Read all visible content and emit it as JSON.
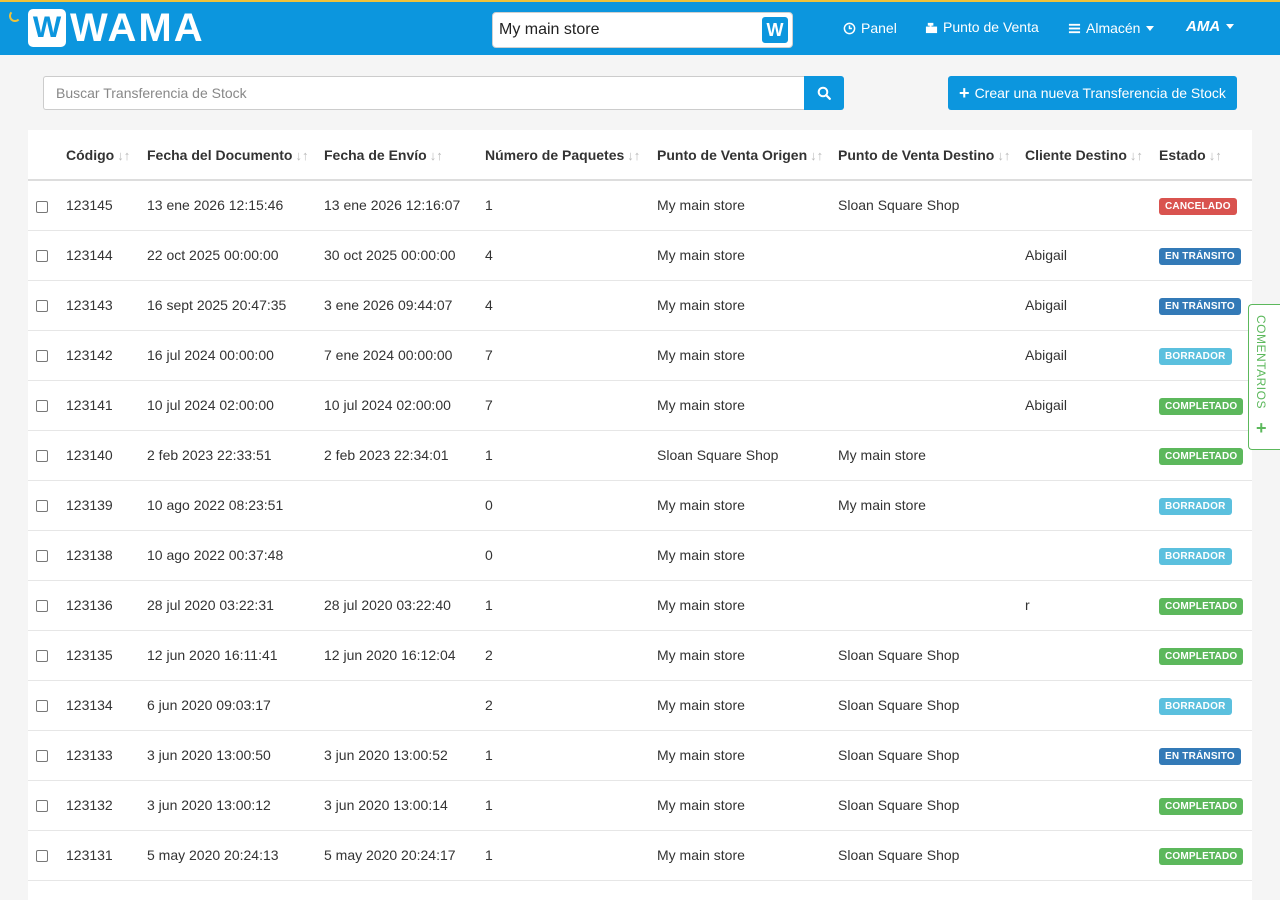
{
  "header": {
    "logo_text": "WAMA",
    "logo_mark": "W",
    "store_selector": {
      "value": "My main store",
      "badge": "W"
    },
    "nav": [
      {
        "label": "Panel",
        "icon": "clock-icon"
      },
      {
        "label": "Punto de Venta",
        "icon": "cash-register-icon"
      },
      {
        "label": "Almacén",
        "icon": "menu-icon"
      }
    ],
    "account_label": "AMA"
  },
  "search": {
    "placeholder": "Buscar Transferencia de Stock",
    "value": ""
  },
  "create_button": {
    "label": "Crear una nueva Transferencia de Stock"
  },
  "table": {
    "columns": [
      "Código",
      "Fecha del Documento",
      "Fecha de Envío",
      "Número de Paquetes",
      "Punto de Venta Origen",
      "Punto de Venta Destino",
      "Cliente Destino",
      "Estado"
    ],
    "rows": [
      {
        "code": "123145",
        "doc_date": "13 ene 2026 12:15:46",
        "ship_date": "13 ene 2026 12:16:07",
        "packages": "1",
        "origin": "My main store",
        "dest": "Sloan Square Shop",
        "client": "",
        "status": "CANCELADO",
        "color": "#d9534f"
      },
      {
        "code": "123144",
        "doc_date": "22 oct 2025 00:00:00",
        "ship_date": "30 oct 2025 00:00:00",
        "packages": "4",
        "origin": "My main store",
        "dest": "",
        "client": "Abigail",
        "status": "EN TRÁNSITO",
        "color": "#337ab7"
      },
      {
        "code": "123143",
        "doc_date": "16 sept 2025 20:47:35",
        "ship_date": "3 ene 2026 09:44:07",
        "packages": "4",
        "origin": "My main store",
        "dest": "",
        "client": "Abigail",
        "status": "EN TRÁNSITO",
        "color": "#337ab7"
      },
      {
        "code": "123142",
        "doc_date": "16 jul 2024 00:00:00",
        "ship_date": "7 ene 2024 00:00:00",
        "packages": "7",
        "origin": "My main store",
        "dest": "",
        "client": "Abigail",
        "status": "BORRADOR",
        "color": "#5bc0de"
      },
      {
        "code": "123141",
        "doc_date": "10 jul 2024 02:00:00",
        "ship_date": "10 jul 2024 02:00:00",
        "packages": "7",
        "origin": "My main store",
        "dest": "",
        "client": "Abigail",
        "status": "COMPLETADO",
        "color": "#5cb85c"
      },
      {
        "code": "123140",
        "doc_date": "2 feb 2023 22:33:51",
        "ship_date": "2 feb 2023 22:34:01",
        "packages": "1",
        "origin": "Sloan Square Shop",
        "dest": "My main store",
        "client": "",
        "status": "COMPLETADO",
        "color": "#5cb85c"
      },
      {
        "code": "123139",
        "doc_date": "10 ago 2022 08:23:51",
        "ship_date": "",
        "packages": "0",
        "origin": "My main store",
        "dest": "My main store",
        "client": "",
        "status": "BORRADOR",
        "color": "#5bc0de"
      },
      {
        "code": "123138",
        "doc_date": "10 ago 2022 00:37:48",
        "ship_date": "",
        "packages": "0",
        "origin": "My main store",
        "dest": "",
        "client": "",
        "status": "BORRADOR",
        "color": "#5bc0de"
      },
      {
        "code": "123136",
        "doc_date": "28 jul 2020 03:22:31",
        "ship_date": "28 jul 2020 03:22:40",
        "packages": "1",
        "origin": "My main store",
        "dest": "",
        "client": "r",
        "status": "COMPLETADO",
        "color": "#5cb85c"
      },
      {
        "code": "123135",
        "doc_date": "12 jun 2020 16:11:41",
        "ship_date": "12 jun 2020 16:12:04",
        "packages": "2",
        "origin": "My main store",
        "dest": "Sloan Square Shop",
        "client": "",
        "status": "COMPLETADO",
        "color": "#5cb85c"
      },
      {
        "code": "123134",
        "doc_date": "6 jun 2020 09:03:17",
        "ship_date": "",
        "packages": "2",
        "origin": "My main store",
        "dest": "Sloan Square Shop",
        "client": "",
        "status": "BORRADOR",
        "color": "#5bc0de"
      },
      {
        "code": "123133",
        "doc_date": "3 jun 2020 13:00:50",
        "ship_date": "3 jun 2020 13:00:52",
        "packages": "1",
        "origin": "My main store",
        "dest": "Sloan Square Shop",
        "client": "",
        "status": "EN TRÁNSITO",
        "color": "#337ab7"
      },
      {
        "code": "123132",
        "doc_date": "3 jun 2020 13:00:12",
        "ship_date": "3 jun 2020 13:00:14",
        "packages": "1",
        "origin": "My main store",
        "dest": "Sloan Square Shop",
        "client": "",
        "status": "COMPLETADO",
        "color": "#5cb85c"
      },
      {
        "code": "123131",
        "doc_date": "5 may 2020 20:24:13",
        "ship_date": "5 may 2020 20:24:17",
        "packages": "1",
        "origin": "My main store",
        "dest": "Sloan Square Shop",
        "client": "",
        "status": "COMPLETADO",
        "color": "#5cb85c"
      }
    ]
  },
  "feedback_tab": {
    "label": "COMENTARIOS",
    "icon": "plus-icon"
  },
  "colors": {
    "brand": "#0c96de",
    "accent": "#f0c23a",
    "cancel": "#d9534f",
    "transit": "#337ab7",
    "draft": "#5bc0de",
    "done": "#5cb85c"
  }
}
